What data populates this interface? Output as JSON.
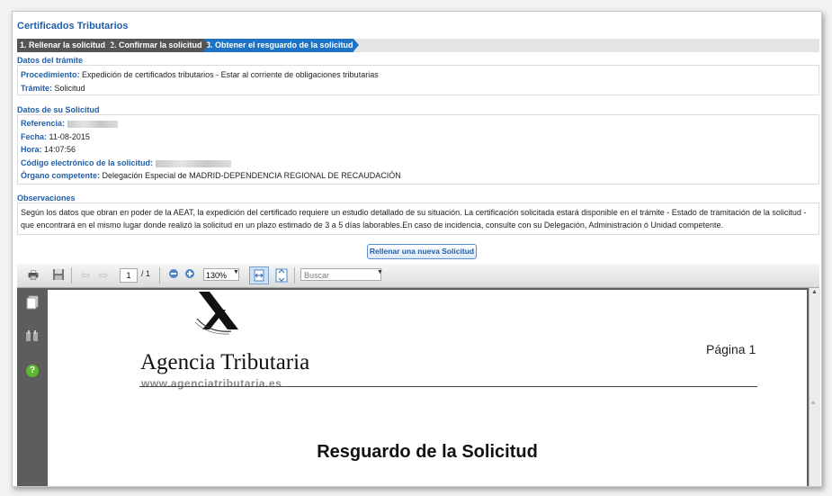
{
  "page_title": "Certificados Tributarios",
  "steps": [
    {
      "label": "1. Rellenar la solicitud"
    },
    {
      "label": "2. Confirmar la solicitud"
    },
    {
      "label": "3. Obtener el resguardo de la solicitud"
    }
  ],
  "tramite": {
    "heading": "Datos del trámite",
    "procedimiento_key": "Procedimiento:",
    "procedimiento_val": "Expedición de certificados tributarios - Estar al corriente de obligaciones tributarias",
    "tramite_key": "Trámite:",
    "tramite_val": "Solicitud"
  },
  "solicitud": {
    "heading": "Datos de su Solicitud",
    "referencia_key": "Referencia:",
    "fecha_key": "Fecha:",
    "fecha_val": "11-08-2015",
    "hora_key": "Hora:",
    "hora_val": "14:07:56",
    "codigo_key": "Código electrónico de la solicitud:",
    "organo_key": "Órgano competente:",
    "organo_val": "Delegación Especial de MADRID-DEPENDENCIA REGIONAL DE RECAUDACIÓN"
  },
  "observaciones": {
    "heading": "Observaciones",
    "text": "Según los datos que obran en poder de la AEAT, la expedición del certificado requiere un estudio detallado de su situación. La certificación solicitada estará disponible en el trámite - Estado de tramitación de la solicitud - que encontrará en el mismo lugar donde realizó la solicitud en un plazo estimado de 3 a 5 días laborables.En caso de incidencia, consulte con su Delegación, Administración ó Unidad competente."
  },
  "new_request_button": "Rellenar una nueva Solicitud",
  "viewer": {
    "current_page": "1",
    "total_pages": "/ 1",
    "zoom": "130%",
    "search_placeholder": "Buscar",
    "icons": [
      "print-icon",
      "save-icon",
      "prev-page-icon",
      "next-page-icon",
      "zoom-out-icon",
      "zoom-in-icon",
      "fit-width-icon",
      "fit-page-icon",
      "pages-icon",
      "attachments-icon",
      "help-icon"
    ]
  },
  "document": {
    "logo_text": "Agencia Tributaria",
    "logo_web": "www.agenciatributaria.es",
    "page_label": "Página 1",
    "title": "Resguardo de la Solicitud"
  },
  "colors": {
    "accent": "#1f5ea8",
    "active_step": "#1f73c4",
    "inactive_step": "#555555"
  }
}
